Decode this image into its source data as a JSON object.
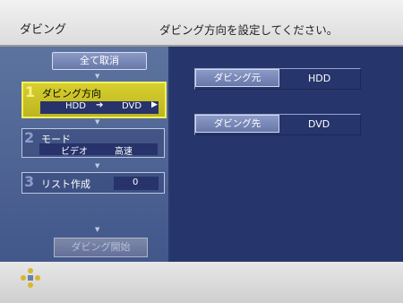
{
  "header": {
    "title": "ダビング",
    "message": "ダビング方向を設定してください。"
  },
  "left": {
    "cancel_all_label": "全て取消",
    "steps": [
      {
        "num": "1",
        "label": "ダビング方向",
        "value_left": "HDD",
        "value_mid": "➔",
        "value_right": "DVD",
        "value_arrow": "▶"
      },
      {
        "num": "2",
        "label": "モード",
        "value_left": "ビデオ",
        "value_right": "高速"
      },
      {
        "num": "3",
        "label": "リスト作成",
        "value": "0"
      }
    ],
    "start_label": "ダビング開始"
  },
  "right": {
    "source": {
      "label": "ダビング元",
      "value": "HDD"
    },
    "dest": {
      "label": "ダビング先",
      "value": "DVD"
    }
  }
}
